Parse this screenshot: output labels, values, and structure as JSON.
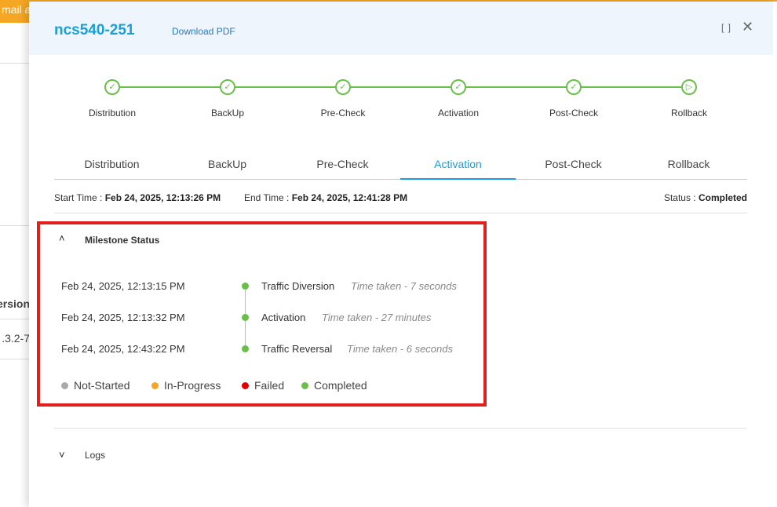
{
  "background": {
    "banner": "mail a",
    "column_header": "ersion",
    "cell": "3.2-7."
  },
  "header": {
    "title": "ncs540-251",
    "download": "Download PDF",
    "expand_icon": "⛶",
    "close_icon": "✕"
  },
  "stepper": [
    {
      "label": "Distribution",
      "state": "completed"
    },
    {
      "label": "BackUp",
      "state": "completed"
    },
    {
      "label": "Pre-Check",
      "state": "completed"
    },
    {
      "label": "Activation",
      "state": "completed"
    },
    {
      "label": "Post-Check",
      "state": "completed"
    },
    {
      "label": "Rollback",
      "state": "skipped"
    }
  ],
  "tabs": [
    {
      "label": "Distribution"
    },
    {
      "label": "BackUp"
    },
    {
      "label": "Pre-Check"
    },
    {
      "label": "Activation",
      "active": true
    },
    {
      "label": "Post-Check"
    },
    {
      "label": "Rollback"
    }
  ],
  "info": {
    "start_label": "Start Time :",
    "start": "Feb 24, 2025, 12:13:26 PM",
    "end_label": "End Time :",
    "end": "Feb 24, 2025, 12:41:28 PM",
    "status_label": "Status :",
    "status": "Completed"
  },
  "milestones": {
    "title": "Milestone Status",
    "items": [
      {
        "date": "Feb 24, 2025, 12:13:15 PM",
        "name": "Traffic Diversion",
        "time": "Time taken - 7 seconds"
      },
      {
        "date": "Feb 24, 2025, 12:13:32 PM",
        "name": "Activation",
        "time": "Time taken - 27 minutes"
      },
      {
        "date": "Feb 24, 2025, 12:43:22 PM",
        "name": "Traffic Reversal",
        "time": "Time taken - 6 seconds"
      }
    ],
    "legend": [
      {
        "label": "Not-Started",
        "color": "#aaaaaa"
      },
      {
        "label": "In-Progress",
        "color": "#f5a623"
      },
      {
        "label": "Failed",
        "color": "#e00000"
      },
      {
        "label": "Completed",
        "color": "#6abf4b"
      }
    ]
  },
  "logs": {
    "title": "Logs"
  }
}
